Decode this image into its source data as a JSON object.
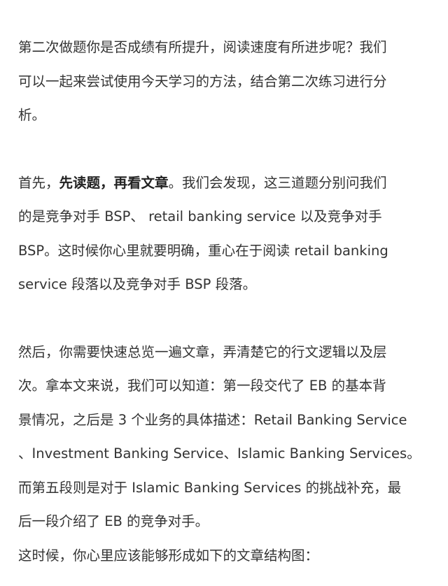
{
  "paragraphs": [
    {
      "lines": [
        "第二次做题你是否成绩有所提升，阅读速度有所进步呢？我们",
        "可以一起来尝试使用今天学习的方法，结合第二次练习进行分",
        "析。"
      ]
    },
    {
      "line1_prefix": "首先，",
      "line1_bold": "先读题，再看文章",
      "line1_suffix": "。我们会发现，这三道题分别问我们",
      "lines_rest": [
        "的是竞争对手 BSP、 retail banking service 以及竞争对手",
        "BSP。这时候你心里就要明确，重心在于阅读 retail banking",
        "service 段落以及竞争对手 BSP 段落。"
      ]
    },
    {
      "lines": [
        "然后，你需要快速总览一遍文章，弄清楚它的行文逻辑以及层",
        "次。拿本文来说，我们可以知道：第一段交代了 EB 的基本背",
        "景情况，之后是 3 个业务的具体描述：Retail Banking Service",
        "、Investment Banking Service、Islamic Banking Services。",
        "而第五段则是对于 Islamic Banking Services 的挑战补充，最",
        "后一段介绍了 EB 的竞争对手。"
      ]
    },
    {
      "lines": [
        "这时候，你心里应该能够形成如下的文章结构图："
      ]
    }
  ]
}
